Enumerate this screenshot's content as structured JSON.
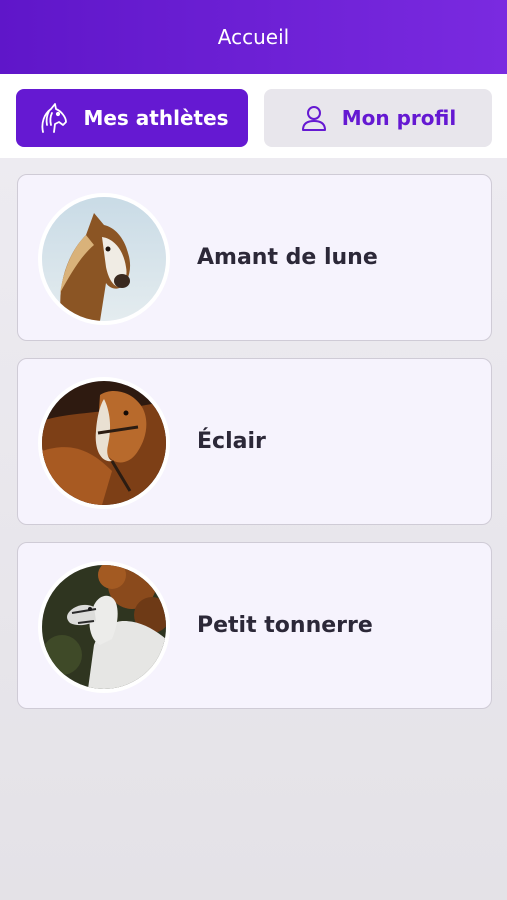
{
  "header": {
    "title": "Accueil"
  },
  "tabs": [
    {
      "label": "Mes athlètes",
      "icon": "horse-head-icon",
      "active": true
    },
    {
      "label": "Mon profil",
      "icon": "person-icon",
      "active": false
    }
  ],
  "athletes": [
    {
      "name": "Amant de lune",
      "photo": "chestnut-horse-photo"
    },
    {
      "name": "Éclair",
      "photo": "bay-horse-photo"
    },
    {
      "name": "Petit tonnerre",
      "photo": "white-horse-photo"
    }
  ],
  "colors": {
    "primary": "#6519d2",
    "card_background": "#f6f3fd",
    "text_dark": "#2c2838"
  }
}
